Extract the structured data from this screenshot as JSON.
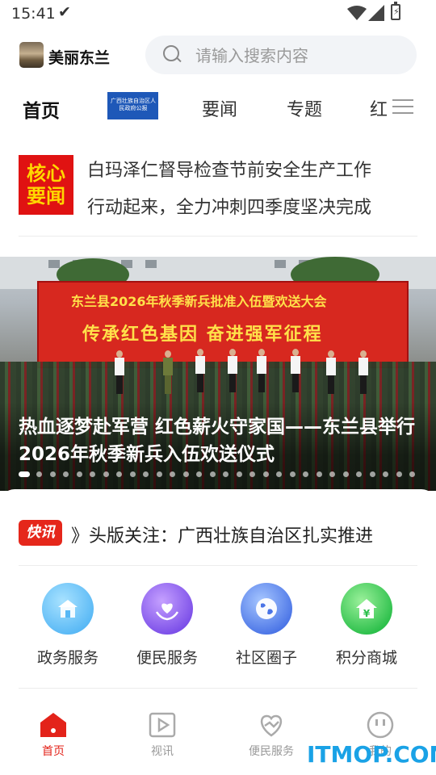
{
  "status_bar": {
    "time": "15:41"
  },
  "header": {
    "app_name": "美丽东兰",
    "search_placeholder": "请输入搜索内容"
  },
  "tabs": [
    {
      "label": "首页"
    },
    {
      "label": "广西壮族自治区人民政府公报"
    },
    {
      "label": "要闻"
    },
    {
      "label": "专题"
    },
    {
      "label": "红"
    }
  ],
  "headline": {
    "badge_line1": "核心",
    "badge_line2": "要闻",
    "line1": "白玛泽仁督导检查节前安全生产工作",
    "line2": "行动起来，全力冲刺四季度坚决完成"
  },
  "banner": {
    "stage_title": "东兰县2026年秋季新兵批准入伍暨欢送大会",
    "stage_slogan": "传承红色基因 奋进强军征程",
    "title": "热血逐梦赴军营 红色薪火守家国——东兰县举行2026年秋季新兵入伍欢送仪式",
    "dot_count": 30,
    "active_dot": 0
  },
  "flash": {
    "badge": "快讯",
    "text": "》头版关注：广西壮族自治区扎实推进"
  },
  "services": [
    {
      "label": "政务服务",
      "icon": "government-icon",
      "color": "#58b8f5"
    },
    {
      "label": "便民服务",
      "icon": "heart-hands-icon",
      "color": "#7b4ee8"
    },
    {
      "label": "社区圈子",
      "icon": "globe-icon",
      "color": "#4a74e6"
    },
    {
      "label": "积分商城",
      "icon": "yuan-house-icon",
      "color": "#2bbf4a"
    }
  ],
  "bottom_nav": [
    {
      "label": "首页",
      "icon": "home-icon",
      "active": true
    },
    {
      "label": "视讯",
      "icon": "video-icon",
      "active": false
    },
    {
      "label": "便民服务",
      "icon": "heart-icon",
      "active": false
    },
    {
      "label": "我的",
      "icon": "profile-icon",
      "active": false
    }
  ],
  "watermark": "ITMOP.COM",
  "colors": {
    "accent": "#e3231a",
    "flash_red": "#e5271b",
    "tab_image_blue": "#1e58b8"
  }
}
